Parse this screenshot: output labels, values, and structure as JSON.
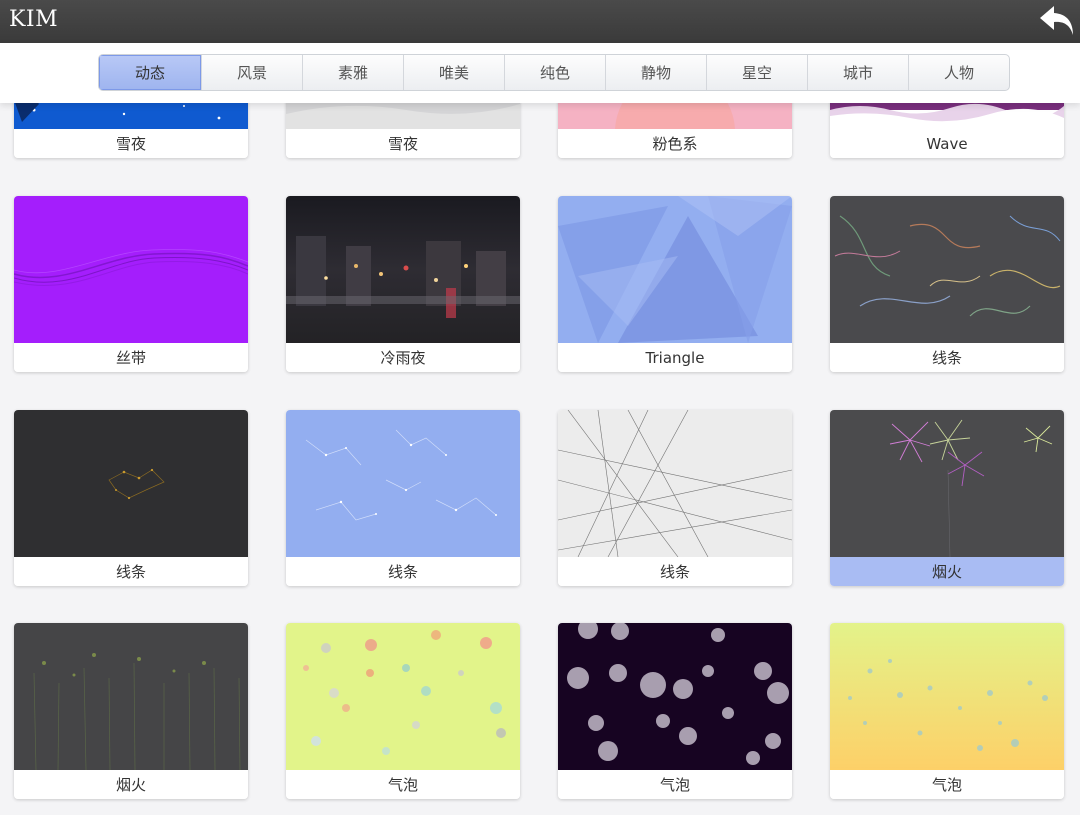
{
  "header": {
    "title": "KIM",
    "back_icon": "back-arrow-icon"
  },
  "tabs": [
    {
      "label": "动态",
      "active": true
    },
    {
      "label": "风景",
      "active": false
    },
    {
      "label": "素雅",
      "active": false
    },
    {
      "label": "唯美",
      "active": false
    },
    {
      "label": "纯色",
      "active": false
    },
    {
      "label": "静物",
      "active": false
    },
    {
      "label": "星空",
      "active": false
    },
    {
      "label": "城市",
      "active": false
    },
    {
      "label": "人物",
      "active": false
    }
  ],
  "wallpapers": [
    {
      "label": "雪夜",
      "theme": "snow-night-blue"
    },
    {
      "label": "雪夜",
      "theme": "snow-night-white"
    },
    {
      "label": "粉色系",
      "theme": "pink"
    },
    {
      "label": "Wave",
      "theme": "wave-purple"
    },
    {
      "label": "丝带",
      "theme": "ribbon-violet"
    },
    {
      "label": "冷雨夜",
      "theme": "rainy-city-night"
    },
    {
      "label": "Triangle",
      "theme": "blue-triangles"
    },
    {
      "label": "线条",
      "theme": "colorful-swirl-lines"
    },
    {
      "label": "线条",
      "theme": "dark-dotted-network"
    },
    {
      "label": "线条",
      "theme": "blue-constellation"
    },
    {
      "label": "线条",
      "theme": "light-crossing-lines"
    },
    {
      "label": "烟火",
      "theme": "fireworks",
      "selected": true
    },
    {
      "label": "烟火",
      "theme": "fireworks-rain"
    },
    {
      "label": "气泡",
      "theme": "bubbles-lime"
    },
    {
      "label": "气泡",
      "theme": "bubbles-dark-purple"
    },
    {
      "label": "气泡",
      "theme": "bubbles-yellow-gradient"
    }
  ],
  "colors": {
    "topbar": "#3f3f3f",
    "active_tab": "#a9bcf3",
    "selected_caption": "#a9bcf3",
    "page_bg": "#f4f4f6"
  }
}
